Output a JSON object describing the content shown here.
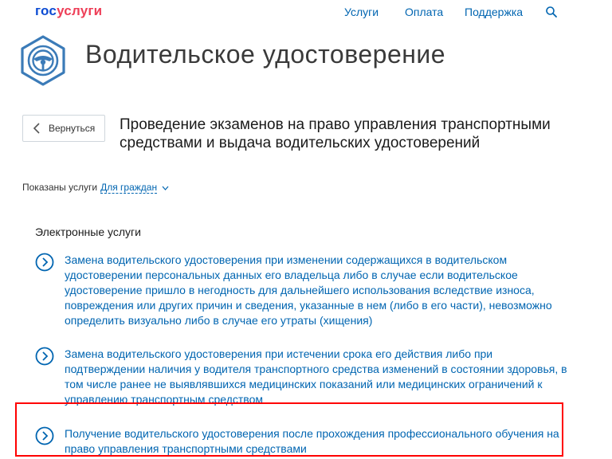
{
  "header": {
    "logo_part1": "гос",
    "logo_part2": "услуги",
    "nav": [
      "Услуги",
      "Оплата",
      "Поддержка"
    ]
  },
  "page": {
    "title": "Водительское удостоверение",
    "back_label": "Вернуться",
    "service_title": "Проведение экзаменов на право управления транспортными средствами и выдача водительских удостоверений"
  },
  "filter": {
    "label": "Показаны услуги",
    "value": "Для граждан"
  },
  "section": {
    "heading": "Электронные услуги",
    "items": [
      {
        "text": "Замена водительского удостоверения при изменении содержащихся в водительском удостоверении персональных данных его владельца либо в случае если водительское удостоверение пришло в негодность для дальнейшего использования вследствие износа, повреждения или других причин и сведения, указанные в нем (либо в его части), невозможно определить визуально либо в случае его утраты (хищения)"
      },
      {
        "text": "Замена водительского удостоверения при истечении срока его действия либо при подтверждении наличия у водителя транспортного средства изменений в состоянии здоровья, в том числе ранее не выявлявшихся медицинских показаний или медицинских ограничений к управлению транспортным средством"
      },
      {
        "text": "Получение водительского удостоверения после прохождения профессионального обучения на право управления транспортными средствами"
      }
    ]
  },
  "colors": {
    "link": "#0065b1",
    "emblem": "#3b7bb8",
    "logo_blue": "#0d4cd3",
    "logo_red": "#ee3f58",
    "highlight": "#ff0000"
  }
}
